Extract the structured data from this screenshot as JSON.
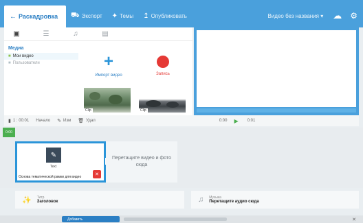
{
  "toolbar": {
    "back_label": "Раскадровка",
    "items": [
      {
        "icon": "car-icon",
        "label": "Экспорт"
      },
      {
        "icon": "magic-icon",
        "label": "Темы"
      },
      {
        "icon": "upload-icon",
        "label": "Опубликовать"
      }
    ],
    "format_select": "Видео без названия ▾",
    "cloud_icon": "cloud-icon",
    "settings_icon": "gear-icon"
  },
  "media": {
    "tab_icons": [
      "film-icon",
      "book-icon",
      "music-icon",
      "text-icon"
    ],
    "title": "Медиа",
    "links": [
      {
        "label": "Мои видео",
        "active": true
      },
      {
        "label": "Пользователи",
        "active": false
      }
    ],
    "import_label": "Импорт видео",
    "record_label": "Запись",
    "thumbs": [
      {
        "caption": "Clip"
      },
      {
        "caption": "Clip"
      }
    ]
  },
  "controls": {
    "items": [
      "1 : 00:01",
      "Начало",
      "Изм",
      "Удал"
    ],
    "time_start": "0:00",
    "time_end": "0:01",
    "play_icon": "play-icon"
  },
  "timeline": {
    "marker_label": "0:00",
    "clip": {
      "sublabel": "Text",
      "name": "Основа тематической рамки для видео",
      "trash_icon": "trash-icon"
    },
    "dropzone_text": "Перетащите видео и фото сюда"
  },
  "tracks": [
    {
      "icon": "wand-icon",
      "small": "Титр",
      "big": "Заголовок"
    },
    {
      "icon": "music-icon",
      "small": "Музыка",
      "big": "Перетащите аудио сюда"
    }
  ],
  "status": {
    "chip_label": "Добавить",
    "close_icon": "close-icon"
  },
  "colors": {
    "accent": "#4aa0dc",
    "primary_blue": "#2b95d9",
    "record_red": "#e53935",
    "play_green": "#4caf50"
  }
}
